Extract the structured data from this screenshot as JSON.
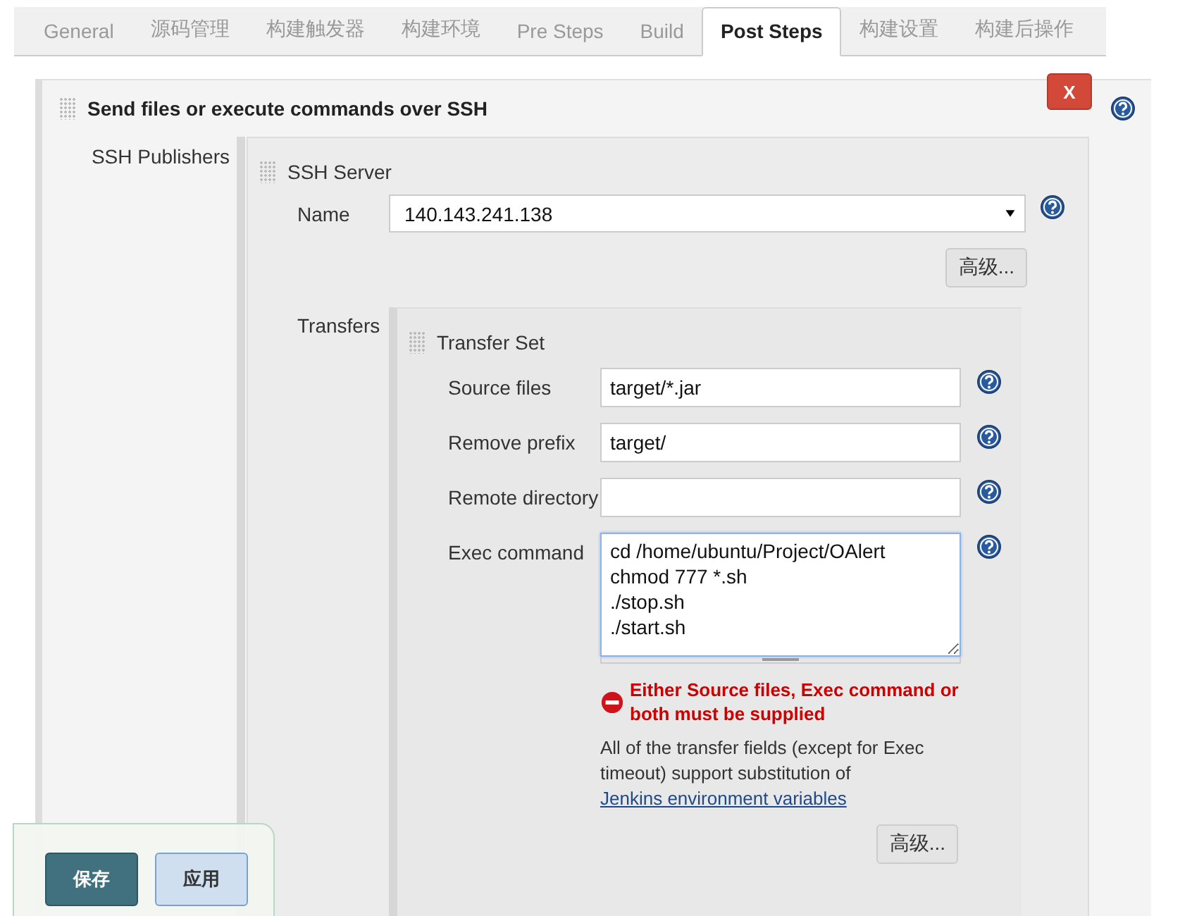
{
  "tabs": [
    {
      "label": "General",
      "selected": false
    },
    {
      "label": "源码管理",
      "selected": false
    },
    {
      "label": "构建触发器",
      "selected": false
    },
    {
      "label": "构建环境",
      "selected": false
    },
    {
      "label": "Pre Steps",
      "selected": false
    },
    {
      "label": "Build",
      "selected": false
    },
    {
      "label": "Post Steps",
      "selected": true
    },
    {
      "label": "构建设置",
      "selected": false
    },
    {
      "label": "构建后操作",
      "selected": false
    }
  ],
  "publisher_section": {
    "title": "Send files or execute commands over SSH",
    "delete_button": "X",
    "label": "SSH Publishers",
    "ssh_server": {
      "title": "SSH Server",
      "name_label": "Name",
      "name_value": "140.143.241.138",
      "advanced_button": "高级...",
      "transfers_label": "Transfers",
      "transfer_set": {
        "title": "Transfer Set",
        "fields": [
          {
            "label": "Source files",
            "kind": "input",
            "value": "target/*.jar"
          },
          {
            "label": "Remove prefix",
            "kind": "input",
            "value": "target/"
          },
          {
            "label": "Remote directory",
            "kind": "input"
          },
          {
            "label": "Exec command",
            "kind": "textarea",
            "value": "cd /home/ubuntu/Project/OAlert\nchmod 777 *.sh\n./stop.sh\n./start.sh"
          }
        ],
        "error": "Either Source files, Exec command or both must be supplied",
        "note": "All of the transfer fields (except for Exec timeout) support substitution of ",
        "note_link": "Jenkins environment variables",
        "advanced_button": "高级..."
      }
    }
  },
  "footer_buttons": [
    {
      "label": "保存",
      "kind": "primary"
    },
    {
      "label": "应用",
      "kind": "secondary"
    }
  ]
}
